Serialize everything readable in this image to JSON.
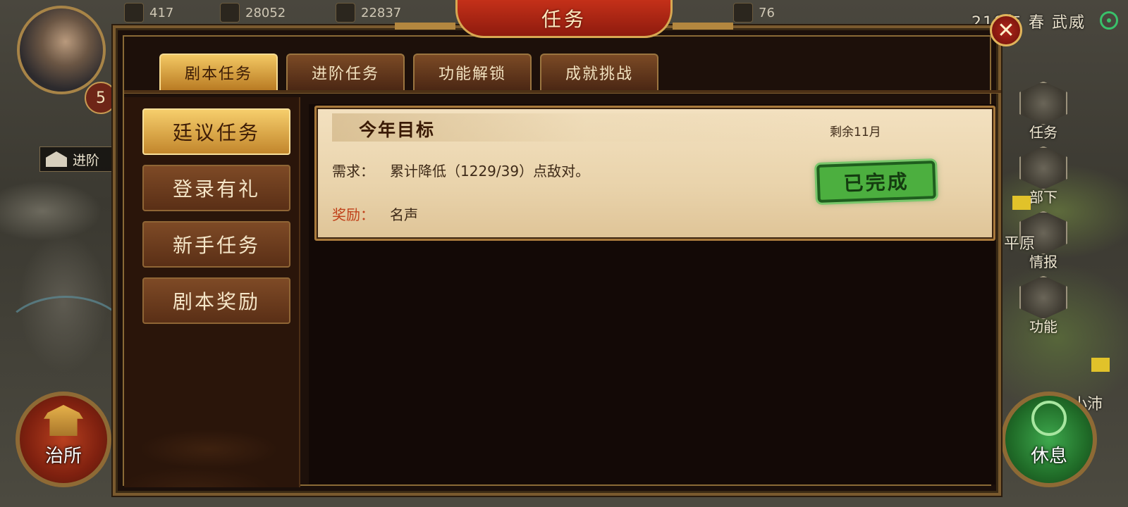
{
  "title": "任务",
  "topbar": {
    "stats": [
      "417",
      "28052",
      "22837",
      "76"
    ],
    "date_text": "219年 春 武威"
  },
  "player": {
    "level": "5"
  },
  "map": {
    "advance_tag": "进阶",
    "labels": [
      "平原",
      "小沛"
    ]
  },
  "side_menu": [
    {
      "label": "任务",
      "icon": "scroll-icon"
    },
    {
      "label": "部下",
      "icon": "helmet-icon"
    },
    {
      "label": "情报",
      "icon": "document-icon"
    },
    {
      "label": "功能",
      "icon": "gear-icon"
    }
  ],
  "buttons": {
    "office": "治所",
    "rest": "休息",
    "close": "✕"
  },
  "tabs": [
    "剧本任务",
    "进阶任务",
    "功能解锁",
    "成就挑战"
  ],
  "categories": [
    "廷议任务",
    "登录有礼",
    "新手任务",
    "剧本奖励"
  ],
  "task": {
    "title": "今年目标",
    "remaining": "剩余11月",
    "requirement_label": "需求：",
    "requirement": "累计降低（1229/39）点敌对。",
    "reward_label": "奖励：",
    "reward": "名声",
    "status": "已完成"
  },
  "colors": {
    "accent_gold": "#f3c863",
    "title_red": "#c43019",
    "done_green": "#4caf3f",
    "reward_label": "#c0411a"
  }
}
